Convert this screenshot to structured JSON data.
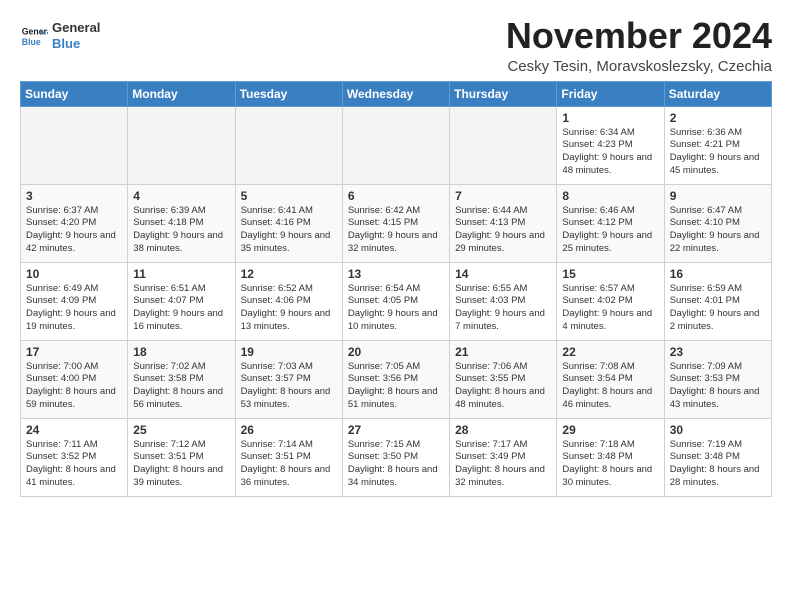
{
  "header": {
    "logo_line1": "General",
    "logo_line2": "Blue",
    "month_title": "November 2024",
    "location": "Cesky Tesin, Moravskoslezsky, Czechia"
  },
  "days_of_week": [
    "Sunday",
    "Monday",
    "Tuesday",
    "Wednesday",
    "Thursday",
    "Friday",
    "Saturday"
  ],
  "weeks": [
    [
      {
        "day": "",
        "empty": true
      },
      {
        "day": "",
        "empty": true
      },
      {
        "day": "",
        "empty": true
      },
      {
        "day": "",
        "empty": true
      },
      {
        "day": "",
        "empty": true
      },
      {
        "day": "1",
        "sunrise": "Sunrise: 6:34 AM",
        "sunset": "Sunset: 4:23 PM",
        "daylight": "Daylight: 9 hours and 48 minutes."
      },
      {
        "day": "2",
        "sunrise": "Sunrise: 6:36 AM",
        "sunset": "Sunset: 4:21 PM",
        "daylight": "Daylight: 9 hours and 45 minutes."
      }
    ],
    [
      {
        "day": "3",
        "sunrise": "Sunrise: 6:37 AM",
        "sunset": "Sunset: 4:20 PM",
        "daylight": "Daylight: 9 hours and 42 minutes."
      },
      {
        "day": "4",
        "sunrise": "Sunrise: 6:39 AM",
        "sunset": "Sunset: 4:18 PM",
        "daylight": "Daylight: 9 hours and 38 minutes."
      },
      {
        "day": "5",
        "sunrise": "Sunrise: 6:41 AM",
        "sunset": "Sunset: 4:16 PM",
        "daylight": "Daylight: 9 hours and 35 minutes."
      },
      {
        "day": "6",
        "sunrise": "Sunrise: 6:42 AM",
        "sunset": "Sunset: 4:15 PM",
        "daylight": "Daylight: 9 hours and 32 minutes."
      },
      {
        "day": "7",
        "sunrise": "Sunrise: 6:44 AM",
        "sunset": "Sunset: 4:13 PM",
        "daylight": "Daylight: 9 hours and 29 minutes."
      },
      {
        "day": "8",
        "sunrise": "Sunrise: 6:46 AM",
        "sunset": "Sunset: 4:12 PM",
        "daylight": "Daylight: 9 hours and 25 minutes."
      },
      {
        "day": "9",
        "sunrise": "Sunrise: 6:47 AM",
        "sunset": "Sunset: 4:10 PM",
        "daylight": "Daylight: 9 hours and 22 minutes."
      }
    ],
    [
      {
        "day": "10",
        "sunrise": "Sunrise: 6:49 AM",
        "sunset": "Sunset: 4:09 PM",
        "daylight": "Daylight: 9 hours and 19 minutes."
      },
      {
        "day": "11",
        "sunrise": "Sunrise: 6:51 AM",
        "sunset": "Sunset: 4:07 PM",
        "daylight": "Daylight: 9 hours and 16 minutes."
      },
      {
        "day": "12",
        "sunrise": "Sunrise: 6:52 AM",
        "sunset": "Sunset: 4:06 PM",
        "daylight": "Daylight: 9 hours and 13 minutes."
      },
      {
        "day": "13",
        "sunrise": "Sunrise: 6:54 AM",
        "sunset": "Sunset: 4:05 PM",
        "daylight": "Daylight: 9 hours and 10 minutes."
      },
      {
        "day": "14",
        "sunrise": "Sunrise: 6:55 AM",
        "sunset": "Sunset: 4:03 PM",
        "daylight": "Daylight: 9 hours and 7 minutes."
      },
      {
        "day": "15",
        "sunrise": "Sunrise: 6:57 AM",
        "sunset": "Sunset: 4:02 PM",
        "daylight": "Daylight: 9 hours and 4 minutes."
      },
      {
        "day": "16",
        "sunrise": "Sunrise: 6:59 AM",
        "sunset": "Sunset: 4:01 PM",
        "daylight": "Daylight: 9 hours and 2 minutes."
      }
    ],
    [
      {
        "day": "17",
        "sunrise": "Sunrise: 7:00 AM",
        "sunset": "Sunset: 4:00 PM",
        "daylight": "Daylight: 8 hours and 59 minutes."
      },
      {
        "day": "18",
        "sunrise": "Sunrise: 7:02 AM",
        "sunset": "Sunset: 3:58 PM",
        "daylight": "Daylight: 8 hours and 56 minutes."
      },
      {
        "day": "19",
        "sunrise": "Sunrise: 7:03 AM",
        "sunset": "Sunset: 3:57 PM",
        "daylight": "Daylight: 8 hours and 53 minutes."
      },
      {
        "day": "20",
        "sunrise": "Sunrise: 7:05 AM",
        "sunset": "Sunset: 3:56 PM",
        "daylight": "Daylight: 8 hours and 51 minutes."
      },
      {
        "day": "21",
        "sunrise": "Sunrise: 7:06 AM",
        "sunset": "Sunset: 3:55 PM",
        "daylight": "Daylight: 8 hours and 48 minutes."
      },
      {
        "day": "22",
        "sunrise": "Sunrise: 7:08 AM",
        "sunset": "Sunset: 3:54 PM",
        "daylight": "Daylight: 8 hours and 46 minutes."
      },
      {
        "day": "23",
        "sunrise": "Sunrise: 7:09 AM",
        "sunset": "Sunset: 3:53 PM",
        "daylight": "Daylight: 8 hours and 43 minutes."
      }
    ],
    [
      {
        "day": "24",
        "sunrise": "Sunrise: 7:11 AM",
        "sunset": "Sunset: 3:52 PM",
        "daylight": "Daylight: 8 hours and 41 minutes."
      },
      {
        "day": "25",
        "sunrise": "Sunrise: 7:12 AM",
        "sunset": "Sunset: 3:51 PM",
        "daylight": "Daylight: 8 hours and 39 minutes."
      },
      {
        "day": "26",
        "sunrise": "Sunrise: 7:14 AM",
        "sunset": "Sunset: 3:51 PM",
        "daylight": "Daylight: 8 hours and 36 minutes."
      },
      {
        "day": "27",
        "sunrise": "Sunrise: 7:15 AM",
        "sunset": "Sunset: 3:50 PM",
        "daylight": "Daylight: 8 hours and 34 minutes."
      },
      {
        "day": "28",
        "sunrise": "Sunrise: 7:17 AM",
        "sunset": "Sunset: 3:49 PM",
        "daylight": "Daylight: 8 hours and 32 minutes."
      },
      {
        "day": "29",
        "sunrise": "Sunrise: 7:18 AM",
        "sunset": "Sunset: 3:48 PM",
        "daylight": "Daylight: 8 hours and 30 minutes."
      },
      {
        "day": "30",
        "sunrise": "Sunrise: 7:19 AM",
        "sunset": "Sunset: 3:48 PM",
        "daylight": "Daylight: 8 hours and 28 minutes."
      }
    ]
  ]
}
